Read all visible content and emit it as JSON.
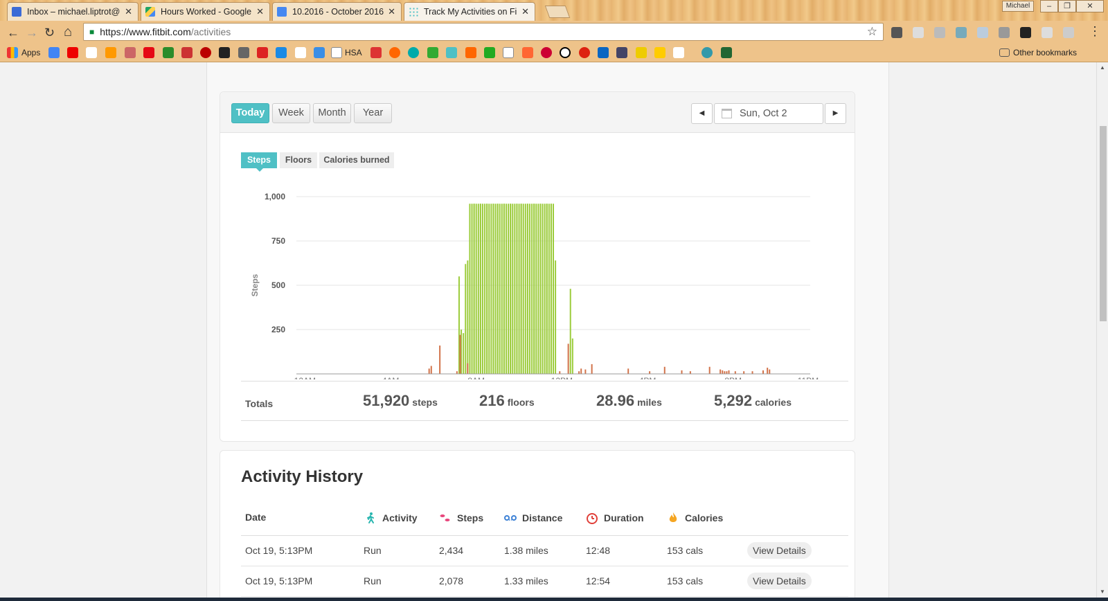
{
  "browser": {
    "tabs": [
      {
        "title": "Inbox – michael.liptrot@",
        "active": false
      },
      {
        "title": "Hours Worked - Google",
        "active": false
      },
      {
        "title": "10.2016 - October 2016 -",
        "active": false
      },
      {
        "title": "Track My Activities on Fi",
        "active": true
      }
    ],
    "close_glyph": "✕",
    "profile_name": "Michael",
    "url_host": "https://www.fitbit.com",
    "url_path": "/activities",
    "bookmarks": {
      "apps_label": "Apps",
      "hsa_label": "HSA",
      "other_label": "Other bookmarks"
    }
  },
  "period_tabs": [
    "Today",
    "Week",
    "Month",
    "Year"
  ],
  "date_label": "Sun, Oct 2",
  "metric_tabs": [
    "Steps",
    "Floors",
    "Calories burned"
  ],
  "colors": {
    "accent": "#4fc0c5",
    "bar_active": "#9ccc3c",
    "bar_light": "#d2734a",
    "grid": "#e6e6e6"
  },
  "chart_data": {
    "type": "bar",
    "ylabel": "Steps",
    "ylim": [
      0,
      1000
    ],
    "yticks": [
      250,
      500,
      750,
      1000
    ],
    "ytick_labels": [
      "250",
      "500",
      "750",
      "1,000"
    ],
    "xlim": [
      0,
      24
    ],
    "xticks": [
      0.4,
      4.4,
      8.4,
      12.4,
      16.4,
      20.4,
      23.9
    ],
    "xtick_labels": [
      "12AM",
      "4AM",
      "8AM",
      "12PM",
      "4PM",
      "8PM",
      "11PM"
    ],
    "series": [
      {
        "name": "active",
        "color": "#9ccc3c",
        "x": [
          7.6,
          7.7,
          7.8,
          7.9,
          8.0,
          8.1,
          8.1,
          8.2,
          8.3,
          8.3,
          8.4,
          8.5,
          8.6,
          8.6,
          8.7,
          8.8,
          8.9,
          8.9,
          9.0,
          9.1,
          9.2,
          9.2,
          9.3,
          9.4,
          9.4,
          9.5,
          9.6,
          9.7,
          9.7,
          9.8,
          9.9,
          10.0,
          10.0,
          10.1,
          10.2,
          10.3,
          10.3,
          10.4,
          10.5,
          10.5,
          10.6,
          10.7,
          10.8,
          10.8,
          10.9,
          11.0,
          11.1,
          11.1,
          11.2,
          11.3,
          11.4,
          11.4,
          11.5,
          11.6,
          11.7,
          11.7,
          11.8,
          11.9,
          11.9,
          12.0,
          12.1,
          12.8,
          12.9
        ],
        "values": [
          550,
          250,
          230,
          620,
          640,
          570,
          960,
          960,
          960,
          960,
          960,
          960,
          960,
          960,
          960,
          960,
          960,
          960,
          960,
          960,
          960,
          960,
          960,
          960,
          960,
          960,
          960,
          960,
          960,
          960,
          960,
          960,
          960,
          960,
          960,
          960,
          960,
          960,
          960,
          960,
          960,
          960,
          960,
          960,
          960,
          960,
          960,
          960,
          960,
          960,
          960,
          960,
          960,
          960,
          960,
          960,
          960,
          960,
          960,
          960,
          640,
          480,
          200
        ]
      },
      {
        "name": "light",
        "color": "#d2734a",
        "x": [
          6.2,
          6.3,
          6.7,
          7.5,
          7.65,
          8.0,
          12.3,
          12.7,
          13.2,
          13.3,
          13.5,
          13.8,
          15.5,
          16.5,
          17.2,
          18.0,
          18.4,
          19.3,
          19.8,
          19.9,
          20.0,
          20.1,
          20.2,
          20.5,
          20.9,
          21.3,
          21.8,
          22.0,
          22.1
        ],
        "values": [
          30,
          45,
          160,
          15,
          220,
          60,
          15,
          170,
          15,
          30,
          25,
          55,
          30,
          15,
          40,
          20,
          15,
          40,
          25,
          20,
          15,
          15,
          20,
          15,
          15,
          15,
          20,
          35,
          25
        ]
      }
    ]
  },
  "totals": {
    "label": "Totals",
    "items": [
      {
        "value": "51,920",
        "unit": "steps"
      },
      {
        "value": "216",
        "unit": "floors"
      },
      {
        "value": "28.96",
        "unit": "miles"
      },
      {
        "value": "5,292",
        "unit": "calories"
      }
    ]
  },
  "history": {
    "title": "Activity History",
    "columns": [
      "Date",
      "Activity",
      "Steps",
      "Distance",
      "Duration",
      "Calories"
    ],
    "view_label": "View Details",
    "rows": [
      {
        "date": "Oct 19, 5:13PM",
        "activity": "Run",
        "steps": "2,434",
        "distance": "1.38 miles",
        "duration": "12:48",
        "calories": "153 cals"
      },
      {
        "date": "Oct 19, 5:13PM",
        "activity": "Run",
        "steps": "2,078",
        "distance": "1.33 miles",
        "duration": "12:54",
        "calories": "153 cals"
      }
    ]
  }
}
